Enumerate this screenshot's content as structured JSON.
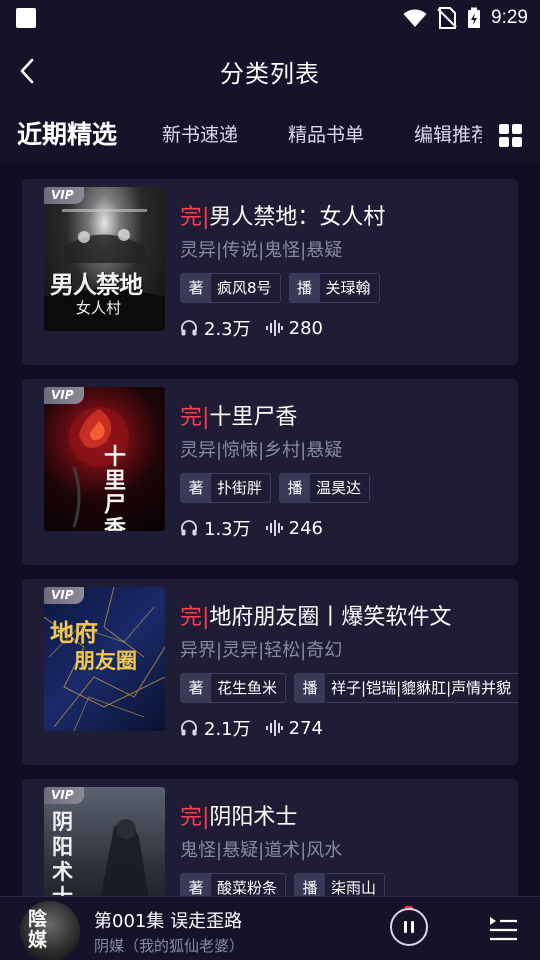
{
  "status_bar": {
    "time": "9:29"
  },
  "header": {
    "title": "分类列表"
  },
  "tabs": [
    {
      "label": "近期精选",
      "active": true
    },
    {
      "label": "新书速递",
      "active": false
    },
    {
      "label": "精品书单",
      "active": false
    },
    {
      "label": "编辑推荐",
      "active": false
    }
  ],
  "books": [
    {
      "vip": "VIP",
      "done": "完|",
      "title": "男人禁地：女人村",
      "tags": "灵异|传说|鬼怪|悬疑",
      "author_key": "著",
      "author": "疯风8号",
      "narrator_key": "播",
      "narrator": "关琭翰",
      "plays": "2.3万",
      "episodes": "280",
      "cover_text": "男人禁地",
      "cover_sub": "女人村"
    },
    {
      "vip": "VIP",
      "done": "完|",
      "title": "十里尸香",
      "tags": "灵异|惊悚|乡村|悬疑",
      "author_key": "著",
      "author": "扑街胖",
      "narrator_key": "播",
      "narrator": "温昊达",
      "plays": "1.3万",
      "episodes": "246",
      "cover_text": "十里尸香",
      "cover_sub": ""
    },
    {
      "vip": "VIP",
      "done": "完|",
      "title": "地府朋友圈丨爆笑软件文",
      "tags": "异界|灵异|轻松|奇幻",
      "author_key": "著",
      "author": "花生鱼米",
      "narrator_key": "播",
      "narrator": "祥子|铠瑞|貔貅肛|声情并貌",
      "plays": "2.1万",
      "episodes": "274",
      "cover_text": "地府",
      "cover_sub": "朋友圈"
    },
    {
      "vip": "VIP",
      "done": "完|",
      "title": "阴阳术士",
      "tags": "鬼怪|悬疑|道术|风水",
      "author_key": "著",
      "author": "酸菜粉条",
      "narrator_key": "播",
      "narrator": "柒雨山",
      "plays": "",
      "episodes": "",
      "cover_text": "阴阳术士",
      "cover_sub": ""
    }
  ],
  "player": {
    "episode_title": "第001集 误走歪路",
    "book_name": "阴媒（我的狐仙老婆）",
    "disc_text": "陰媒"
  },
  "colors": {
    "accent": "#ff3c4f",
    "background": "#14132a",
    "card": "#1e1d35"
  }
}
